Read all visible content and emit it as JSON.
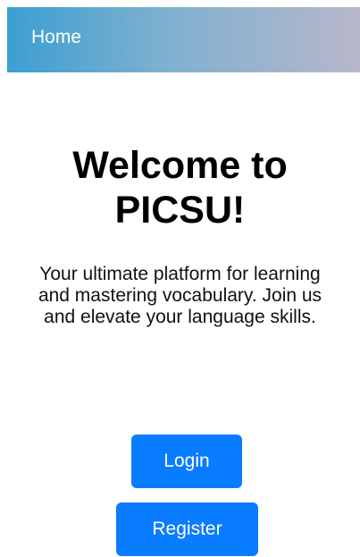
{
  "nav": {
    "home_label": "Home",
    "colors": {
      "gradient_start": "#3b9fd1",
      "gradient_end": "#b8b7ca"
    }
  },
  "hero": {
    "title": "Welcome to PICSU!",
    "subtitle": "Your ultimate platform for learning and mastering vocabulary. Join us and elevate your language skills."
  },
  "actions": {
    "login_label": "Login",
    "register_label": "Register",
    "button_color": "#0a7cff"
  }
}
